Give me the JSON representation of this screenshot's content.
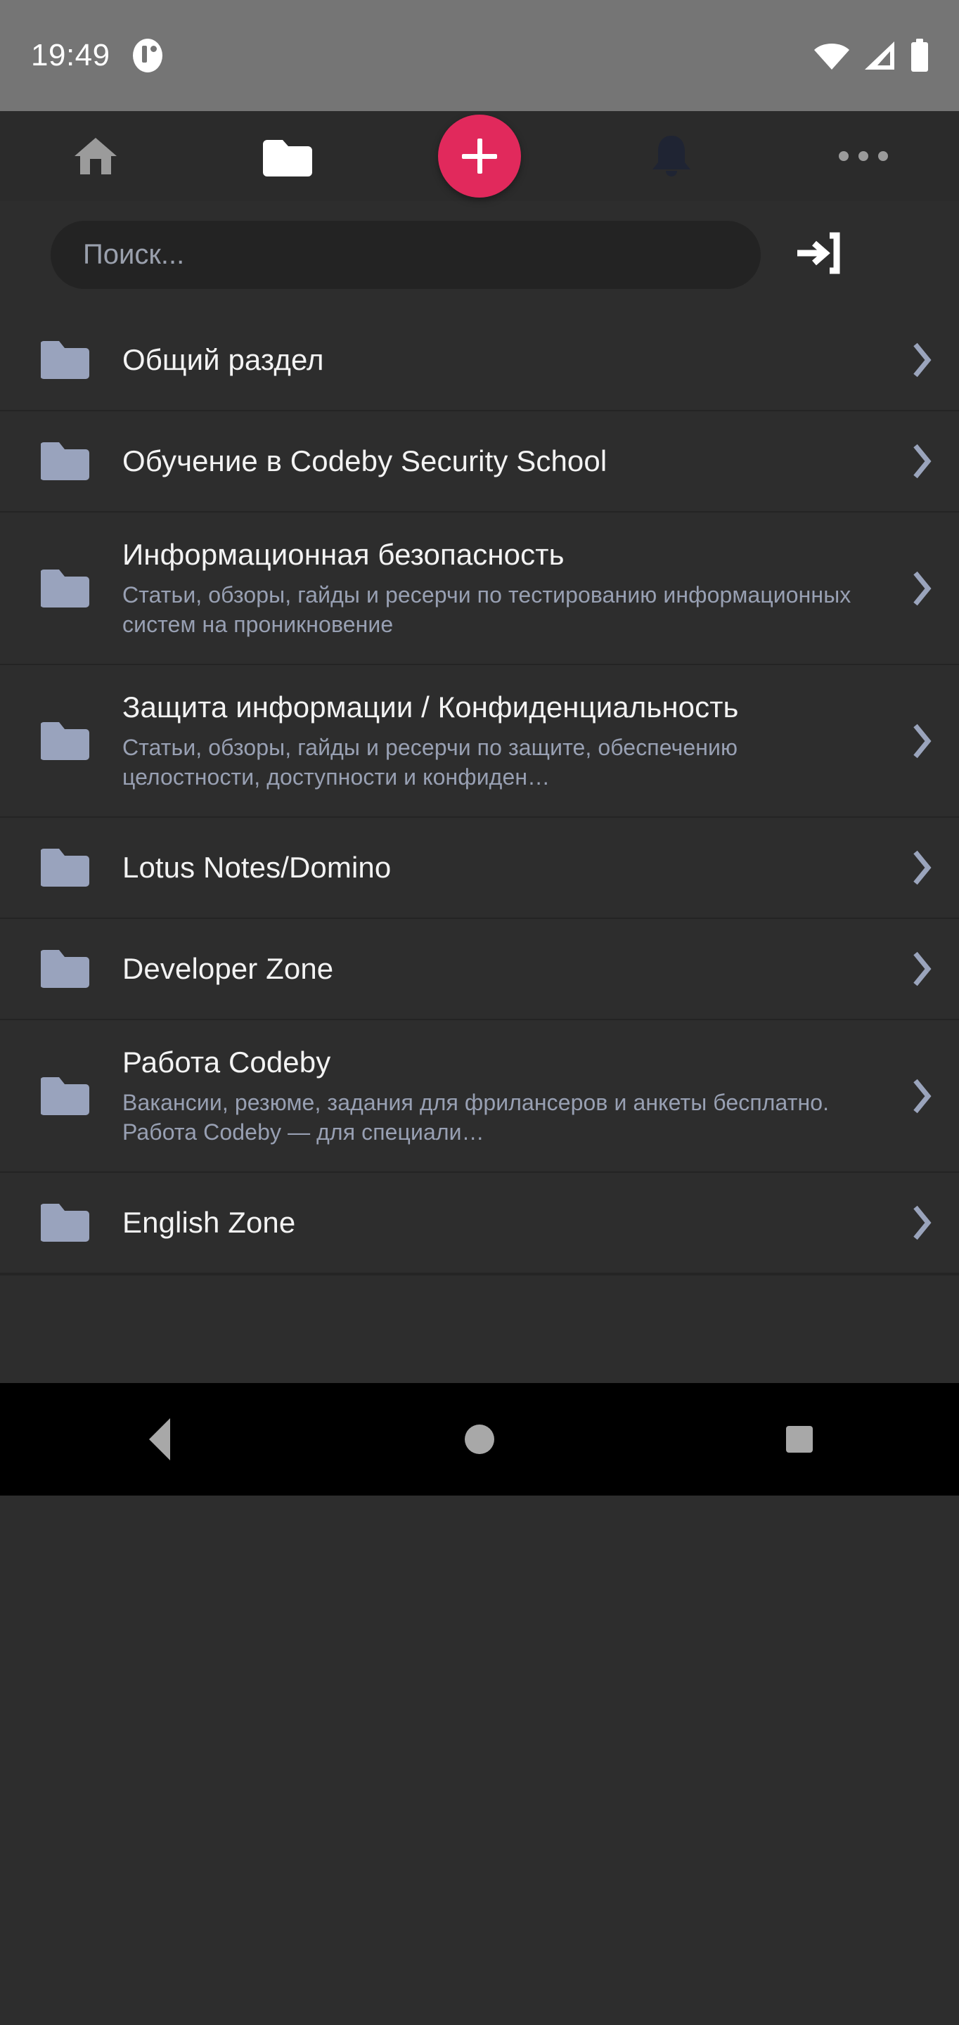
{
  "status_bar": {
    "time": "19:49",
    "app_icon": "notification-app-icon",
    "wifi_icon": "wifi-icon",
    "signal_icon": "cellular-signal-icon",
    "battery_icon": "battery-icon",
    "background": "#757575"
  },
  "toolbar": {
    "background": "#2b2b2b",
    "items": [
      {
        "name": "home-icon",
        "label": "Home",
        "active": false,
        "color": "#9b9b9b"
      },
      {
        "name": "folder-icon",
        "label": "Forums",
        "active": true,
        "color": "#ffffff"
      },
      {
        "name": "plus-icon",
        "label": "Create",
        "active": false,
        "color": "#ffffff"
      },
      {
        "name": "bell-icon",
        "label": "Alerts",
        "active": false,
        "color": "#1f2433"
      },
      {
        "name": "more-icon",
        "label": "More",
        "active": false,
        "color": "#9b9b9b"
      }
    ],
    "fab": {
      "label": "+",
      "color": "#e1295c"
    }
  },
  "search": {
    "placeholder": "Поиск...",
    "value": "",
    "login_icon": "login-icon",
    "login_label": "Войти"
  },
  "list": {
    "accent_folder_color": "#99a3bd",
    "chevron_color": "#9aa4bc",
    "items": [
      {
        "title": "Общий раздел",
        "description": "",
        "icon": "folder-icon"
      },
      {
        "title": "Обучение в Codeby Security School",
        "description": "",
        "icon": "folder-icon"
      },
      {
        "title": "Информационная безопасность",
        "description": "Статьи, обзоры, гайды и ресерчи по тестированию информационных систем на проникновение",
        "icon": "folder-icon"
      },
      {
        "title": "Защита информации / Конфиденциальность",
        "description": "Статьи, обзоры, гайды и ресерчи по защите, обеспечению целостности, доступности и конфиден…",
        "icon": "folder-icon"
      },
      {
        "title": "Lotus Notes/Domino",
        "description": "",
        "icon": "folder-icon"
      },
      {
        "title": "Developer Zone",
        "description": "",
        "icon": "folder-icon"
      },
      {
        "title": "Работа Codeby",
        "description": "Вакансии, резюме, задания для фрилансеров и анкеты бесплатно. Работа Codeby — для специали…",
        "icon": "folder-icon"
      },
      {
        "title": "English Zone",
        "description": "",
        "icon": "folder-icon"
      }
    ]
  },
  "navbar": {
    "back_icon": "back-triangle-icon",
    "home_icon": "home-circle-icon",
    "recents_icon": "recents-square-icon",
    "background": "#000000"
  }
}
